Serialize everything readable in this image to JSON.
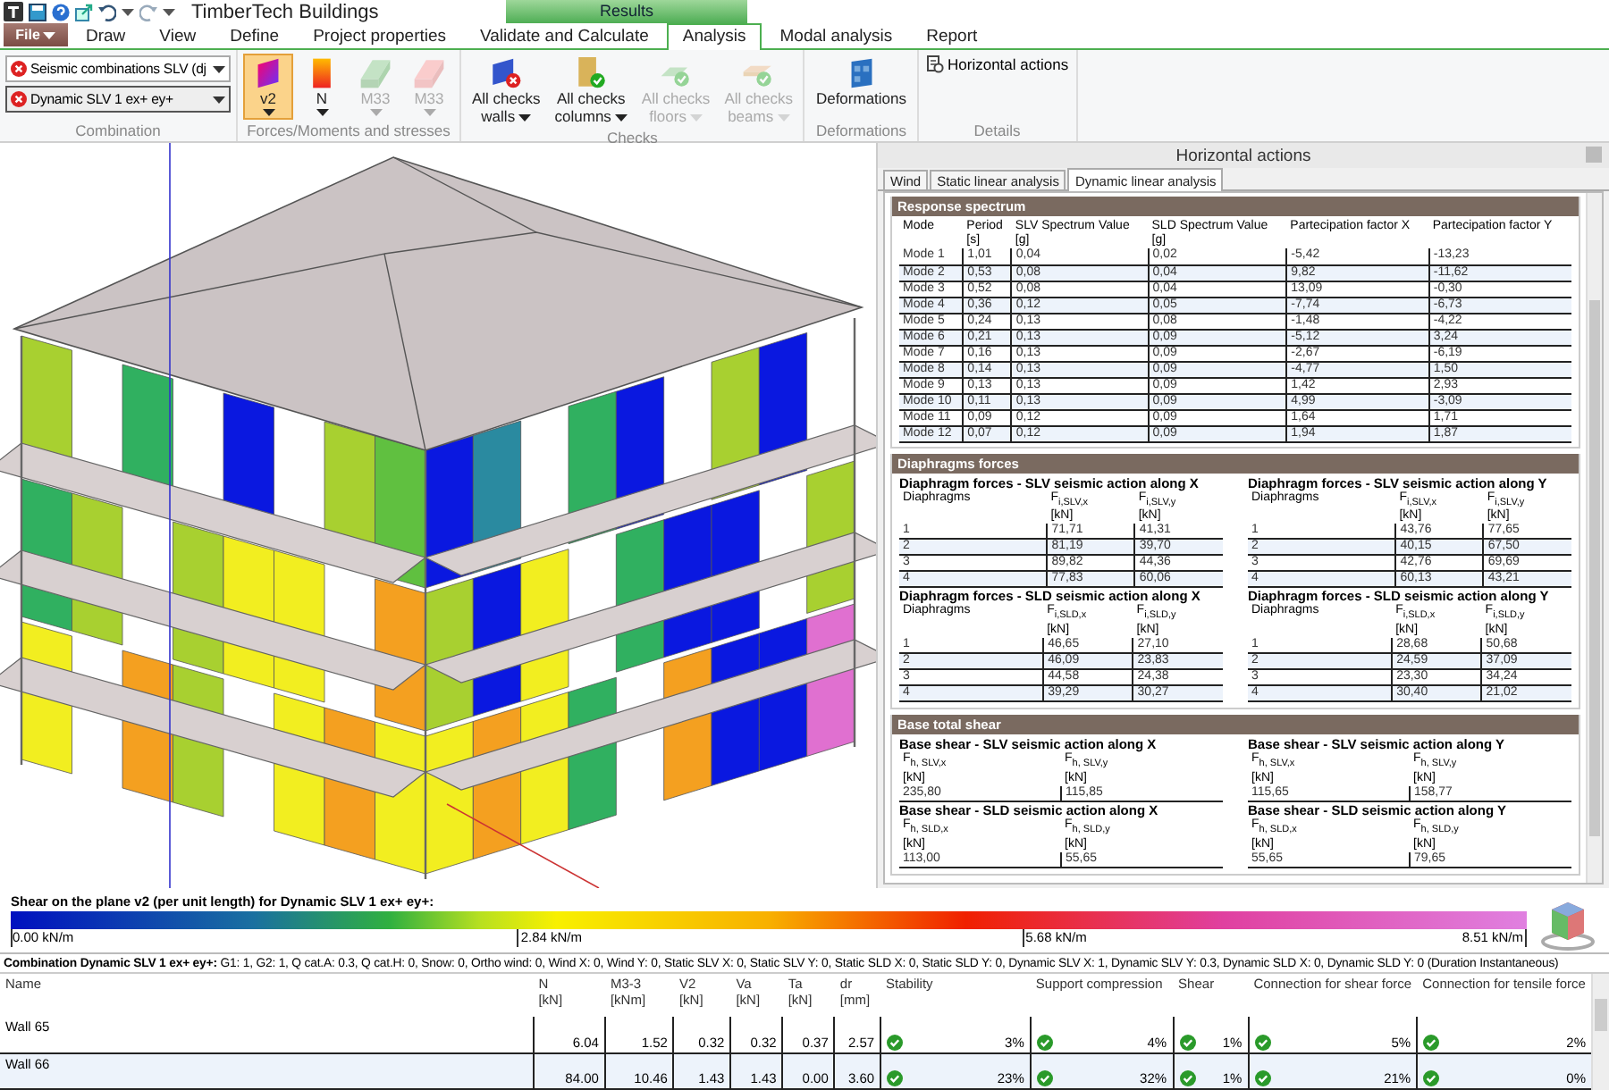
{
  "title_bar": {
    "title": "TimberTech Buildings",
    "context_tab": "Results"
  },
  "file_menu": {
    "label": "File"
  },
  "menu_tabs": [
    {
      "label": "Draw",
      "selected": false
    },
    {
      "label": "View",
      "selected": false
    },
    {
      "label": "Define",
      "selected": false
    },
    {
      "label": "Project properties",
      "selected": false
    },
    {
      "label": "Validate and Calculate",
      "selected": false
    },
    {
      "label": "Analysis",
      "selected": true
    },
    {
      "label": "Modal analysis",
      "selected": false
    },
    {
      "label": "Report",
      "selected": false
    }
  ],
  "ribbon": {
    "groups": [
      {
        "label": "Combination",
        "kind": "dropdowns",
        "items": [
          {
            "label": "Seismic combinations SLV (dj"
          },
          {
            "label": "Dynamic SLV 1 ex+ ey+"
          }
        ]
      },
      {
        "label": "Forces/Moments and stresses",
        "kind": "buttons",
        "items": [
          {
            "label": "v2",
            "selected": true,
            "disabled": false,
            "dropdown": true
          },
          {
            "label": "N",
            "selected": false,
            "disabled": false,
            "dropdown": true
          },
          {
            "label": "M33",
            "selected": false,
            "disabled": true,
            "dropdown": true
          },
          {
            "label": "M33",
            "selected": false,
            "disabled": true,
            "dropdown": true
          }
        ]
      },
      {
        "label": "Checks",
        "kind": "buttons",
        "items": [
          {
            "label": "All checks",
            "sublabel": "walls",
            "selected": false,
            "disabled": false,
            "dropdown": true
          },
          {
            "label": "All checks",
            "sublabel": "columns",
            "selected": false,
            "disabled": false,
            "dropdown": true
          },
          {
            "label": "All checks",
            "sublabel": "floors",
            "selected": false,
            "disabled": true,
            "dropdown": true
          },
          {
            "label": "All checks",
            "sublabel": "beams",
            "selected": false,
            "disabled": true,
            "dropdown": true
          }
        ]
      },
      {
        "label": "Deformations",
        "kind": "buttons",
        "items": [
          {
            "label": "Deformations",
            "selected": false,
            "disabled": false,
            "dropdown": false
          }
        ]
      },
      {
        "label": "Details",
        "kind": "links",
        "items": [
          {
            "label": "Horizontal actions"
          }
        ]
      }
    ]
  },
  "horizontal_actions": {
    "title": "Horizontal actions",
    "tabs": [
      {
        "label": "Wind",
        "selected": false
      },
      {
        "label": "Static linear analysis",
        "selected": false
      },
      {
        "label": "Dynamic linear analysis",
        "selected": true
      }
    ],
    "sections": [
      {
        "title": "Response spectrum",
        "kind": "table",
        "tables": [
          {
            "columns": [
              {
                "label": "Mode"
              },
              {
                "label": "Period",
                "unit": "[s]"
              },
              {
                "label": "SLV Spectrum Value",
                "unit": "[g]"
              },
              {
                "label": "SLD Spectrum Value",
                "unit": "[g]"
              },
              {
                "label": "Partecipation factor X"
              },
              {
                "label": "Partecipation factor Y"
              }
            ],
            "rows": [
              [
                "Mode 1",
                "1,01",
                "0,04",
                "0,02",
                "-5,42",
                "-13,23"
              ],
              [
                "Mode 2",
                "0,53",
                "0,08",
                "0,04",
                "9,82",
                "-11,62"
              ],
              [
                "Mode 3",
                "0,52",
                "0,08",
                "0,04",
                "13,09",
                "-0,30"
              ],
              [
                "Mode 4",
                "0,36",
                "0,12",
                "0,05",
                "-7,74",
                "-6,73"
              ],
              [
                "Mode 5",
                "0,24",
                "0,13",
                "0,08",
                "-1,48",
                "-4,22"
              ],
              [
                "Mode 6",
                "0,21",
                "0,13",
                "0,09",
                "-5,12",
                "3,24"
              ],
              [
                "Mode 7",
                "0,16",
                "0,13",
                "0,09",
                "-2,67",
                "-6,19"
              ],
              [
                "Mode 8",
                "0,14",
                "0,13",
                "0,09",
                "-4,77",
                "1,50"
              ],
              [
                "Mode 9",
                "0,13",
                "0,13",
                "0,09",
                "1,42",
                "2,93"
              ],
              [
                "Mode 10",
                "0,11",
                "0,13",
                "0,09",
                "4,99",
                "-3,09"
              ],
              [
                "Mode 11",
                "0,09",
                "0,12",
                "0,09",
                "1,64",
                "1,71"
              ],
              [
                "Mode 12",
                "0,07",
                "0,12",
                "0,09",
                "1,94",
                "1,87"
              ]
            ]
          }
        ]
      },
      {
        "title": "Diaphragms forces",
        "kind": "grid",
        "tables": [
          {
            "title": "Diaphragm forces - SLV seismic action along X",
            "columns": [
              {
                "label": "Diaphragms"
              },
              {
                "label": "F$_{i,SLV,x}$",
                "unit": "[kN]"
              },
              {
                "label": "F$_{i,SLV,y}$",
                "unit": "[kN]"
              }
            ],
            "rows": [
              [
                "1",
                "71,71",
                "41,31"
              ],
              [
                "2",
                "81,19",
                "39,70"
              ],
              [
                "3",
                "89,82",
                "44,36"
              ],
              [
                "4",
                "77,83",
                "60,06"
              ]
            ]
          },
          {
            "title": "Diaphragm forces - SLV seismic action along Y",
            "columns": [
              {
                "label": "Diaphragms"
              },
              {
                "label": "F$_{i,SLV,x}$",
                "unit": "[kN]"
              },
              {
                "label": "F$_{i,SLV,y}$",
                "unit": "[kN]"
              }
            ],
            "rows": [
              [
                "1",
                "43,76",
                "77,65"
              ],
              [
                "2",
                "40,15",
                "67,50"
              ],
              [
                "3",
                "42,76",
                "69,69"
              ],
              [
                "4",
                "60,13",
                "43,21"
              ]
            ]
          },
          {
            "title": "Diaphragm forces - SLD seismic action along X",
            "columns": [
              {
                "label": "Diaphragms"
              },
              {
                "label": "F$_{i,SLD,x}$",
                "unit": "[kN]"
              },
              {
                "label": "F$_{i,SLD,y}$",
                "unit": "[kN]"
              }
            ],
            "rows": [
              [
                "1",
                "46,65",
                "27,10"
              ],
              [
                "2",
                "46,09",
                "23,83"
              ],
              [
                "3",
                "44,58",
                "24,38"
              ],
              [
                "4",
                "39,29",
                "30,27"
              ]
            ]
          },
          {
            "title": "Diaphragm forces - SLD seismic action along Y",
            "columns": [
              {
                "label": "Diaphragms"
              },
              {
                "label": "F$_{i,SLD,x}$",
                "unit": "[kN]"
              },
              {
                "label": "F$_{i,SLD,y}$",
                "unit": "[kN]"
              }
            ],
            "rows": [
              [
                "1",
                "28,68",
                "50,68"
              ],
              [
                "2",
                "24,59",
                "37,09"
              ],
              [
                "3",
                "23,30",
                "34,24"
              ],
              [
                "4",
                "30,40",
                "21,02"
              ]
            ]
          }
        ]
      },
      {
        "title": "Base total shear",
        "kind": "grid",
        "tables": [
          {
            "title": "Base shear - SLV seismic action along X",
            "columns": [
              {
                "label": "F$_{h, SLV,x}$",
                "unit": "[kN]"
              },
              {
                "label": "F$_{h, SLV,y}$",
                "unit": "[kN]"
              }
            ],
            "rows": [
              [
                "235,80",
                "115,85"
              ]
            ]
          },
          {
            "title": "Base shear - SLV seismic action along Y",
            "columns": [
              {
                "label": "F$_{h, SLV,x}$",
                "unit": "[kN]"
              },
              {
                "label": "F$_{h, SLV,y}$",
                "unit": "[kN]"
              }
            ],
            "rows": [
              [
                "115,65",
                "158,77"
              ]
            ]
          },
          {
            "title": "Base shear - SLD seismic action along X",
            "columns": [
              {
                "label": "F$_{h, SLD,x}$",
                "unit": "[kN]"
              },
              {
                "label": "F$_{h, SLD,y}$",
                "unit": "[kN]"
              }
            ],
            "rows": [
              [
                "113,00",
                "55,65"
              ]
            ]
          },
          {
            "title": "Base shear - SLD seismic action along Y",
            "columns": [
              {
                "label": "F$_{h, SLD,x}$",
                "unit": "[kN]"
              },
              {
                "label": "F$_{h, SLD,y}$",
                "unit": "[kN]"
              }
            ],
            "rows": [
              [
                "55,65",
                "79,65"
              ]
            ]
          }
        ]
      }
    ]
  },
  "legend": {
    "title": "Shear on the plane v2 (per unit length) for Dynamic SLV 1 ex+ ey+:",
    "ticks": [
      "0.00 kN/m",
      "2.84 kN/m",
      "5.68 kN/m",
      "8.51 kN/m"
    ]
  },
  "results": {
    "combination": "**Combination Dynamic SLV 1 ex+ ey+:** G1: 1, G2: 1, Q cat.A: 0.3, Q cat.H: 0, Snow: 0, Ortho wind: 0, Wind X: 0, Wind Y: 0, Static SLV X: 0, Static SLV Y: 0, Static SLD X: 0, Static SLD Y: 0, Dynamic SLV X: 1, Dynamic SLV Y: 0.3, Dynamic SLD X: 0, Dynamic SLD Y: 0 (Duration Instantaneous)",
    "columns": [
      {
        "label": "Name"
      },
      {
        "label": "N",
        "unit": "[kN]"
      },
      {
        "label": "M3-3",
        "unit": "[kNm]"
      },
      {
        "label": "V2",
        "unit": "[kN]"
      },
      {
        "label": "Va",
        "unit": "[kN]"
      },
      {
        "label": "Ta",
        "unit": "[kN]"
      },
      {
        "label": "dr",
        "unit": "[mm]"
      },
      {
        "label": "Stability"
      },
      {
        "label": "Support compression"
      },
      {
        "label": "Shear"
      },
      {
        "label": "Connection for shear force"
      },
      {
        "label": "Connection for tensile force"
      }
    ],
    "rows": [
      {
        "cells": [
          {
            "text": "Wall 65"
          },
          {
            "text": "6.04"
          },
          {
            "text": "1.52"
          },
          {
            "text": "0.32"
          },
          {
            "text": "0.32"
          },
          {
            "text": "0.37"
          },
          {
            "text": "2.57"
          },
          {
            "text": "3%",
            "passed": true
          },
          {
            "text": "4%",
            "passed": true
          },
          {
            "text": "1%",
            "passed": true
          },
          {
            "text": "5%",
            "passed": true
          },
          {
            "text": "2%",
            "passed": true
          }
        ]
      },
      {
        "cells": [
          {
            "text": "Wall 66"
          },
          {
            "text": "84.00"
          },
          {
            "text": "10.46"
          },
          {
            "text": "1.43"
          },
          {
            "text": "1.43"
          },
          {
            "text": "0.00"
          },
          {
            "text": "3.60"
          },
          {
            "text": "23%",
            "passed": true
          },
          {
            "text": "32%",
            "passed": true
          },
          {
            "text": "1%",
            "passed": true
          },
          {
            "text": "21%",
            "passed": true
          },
          {
            "text": "0%",
            "passed": true
          }
        ]
      }
    ]
  }
}
